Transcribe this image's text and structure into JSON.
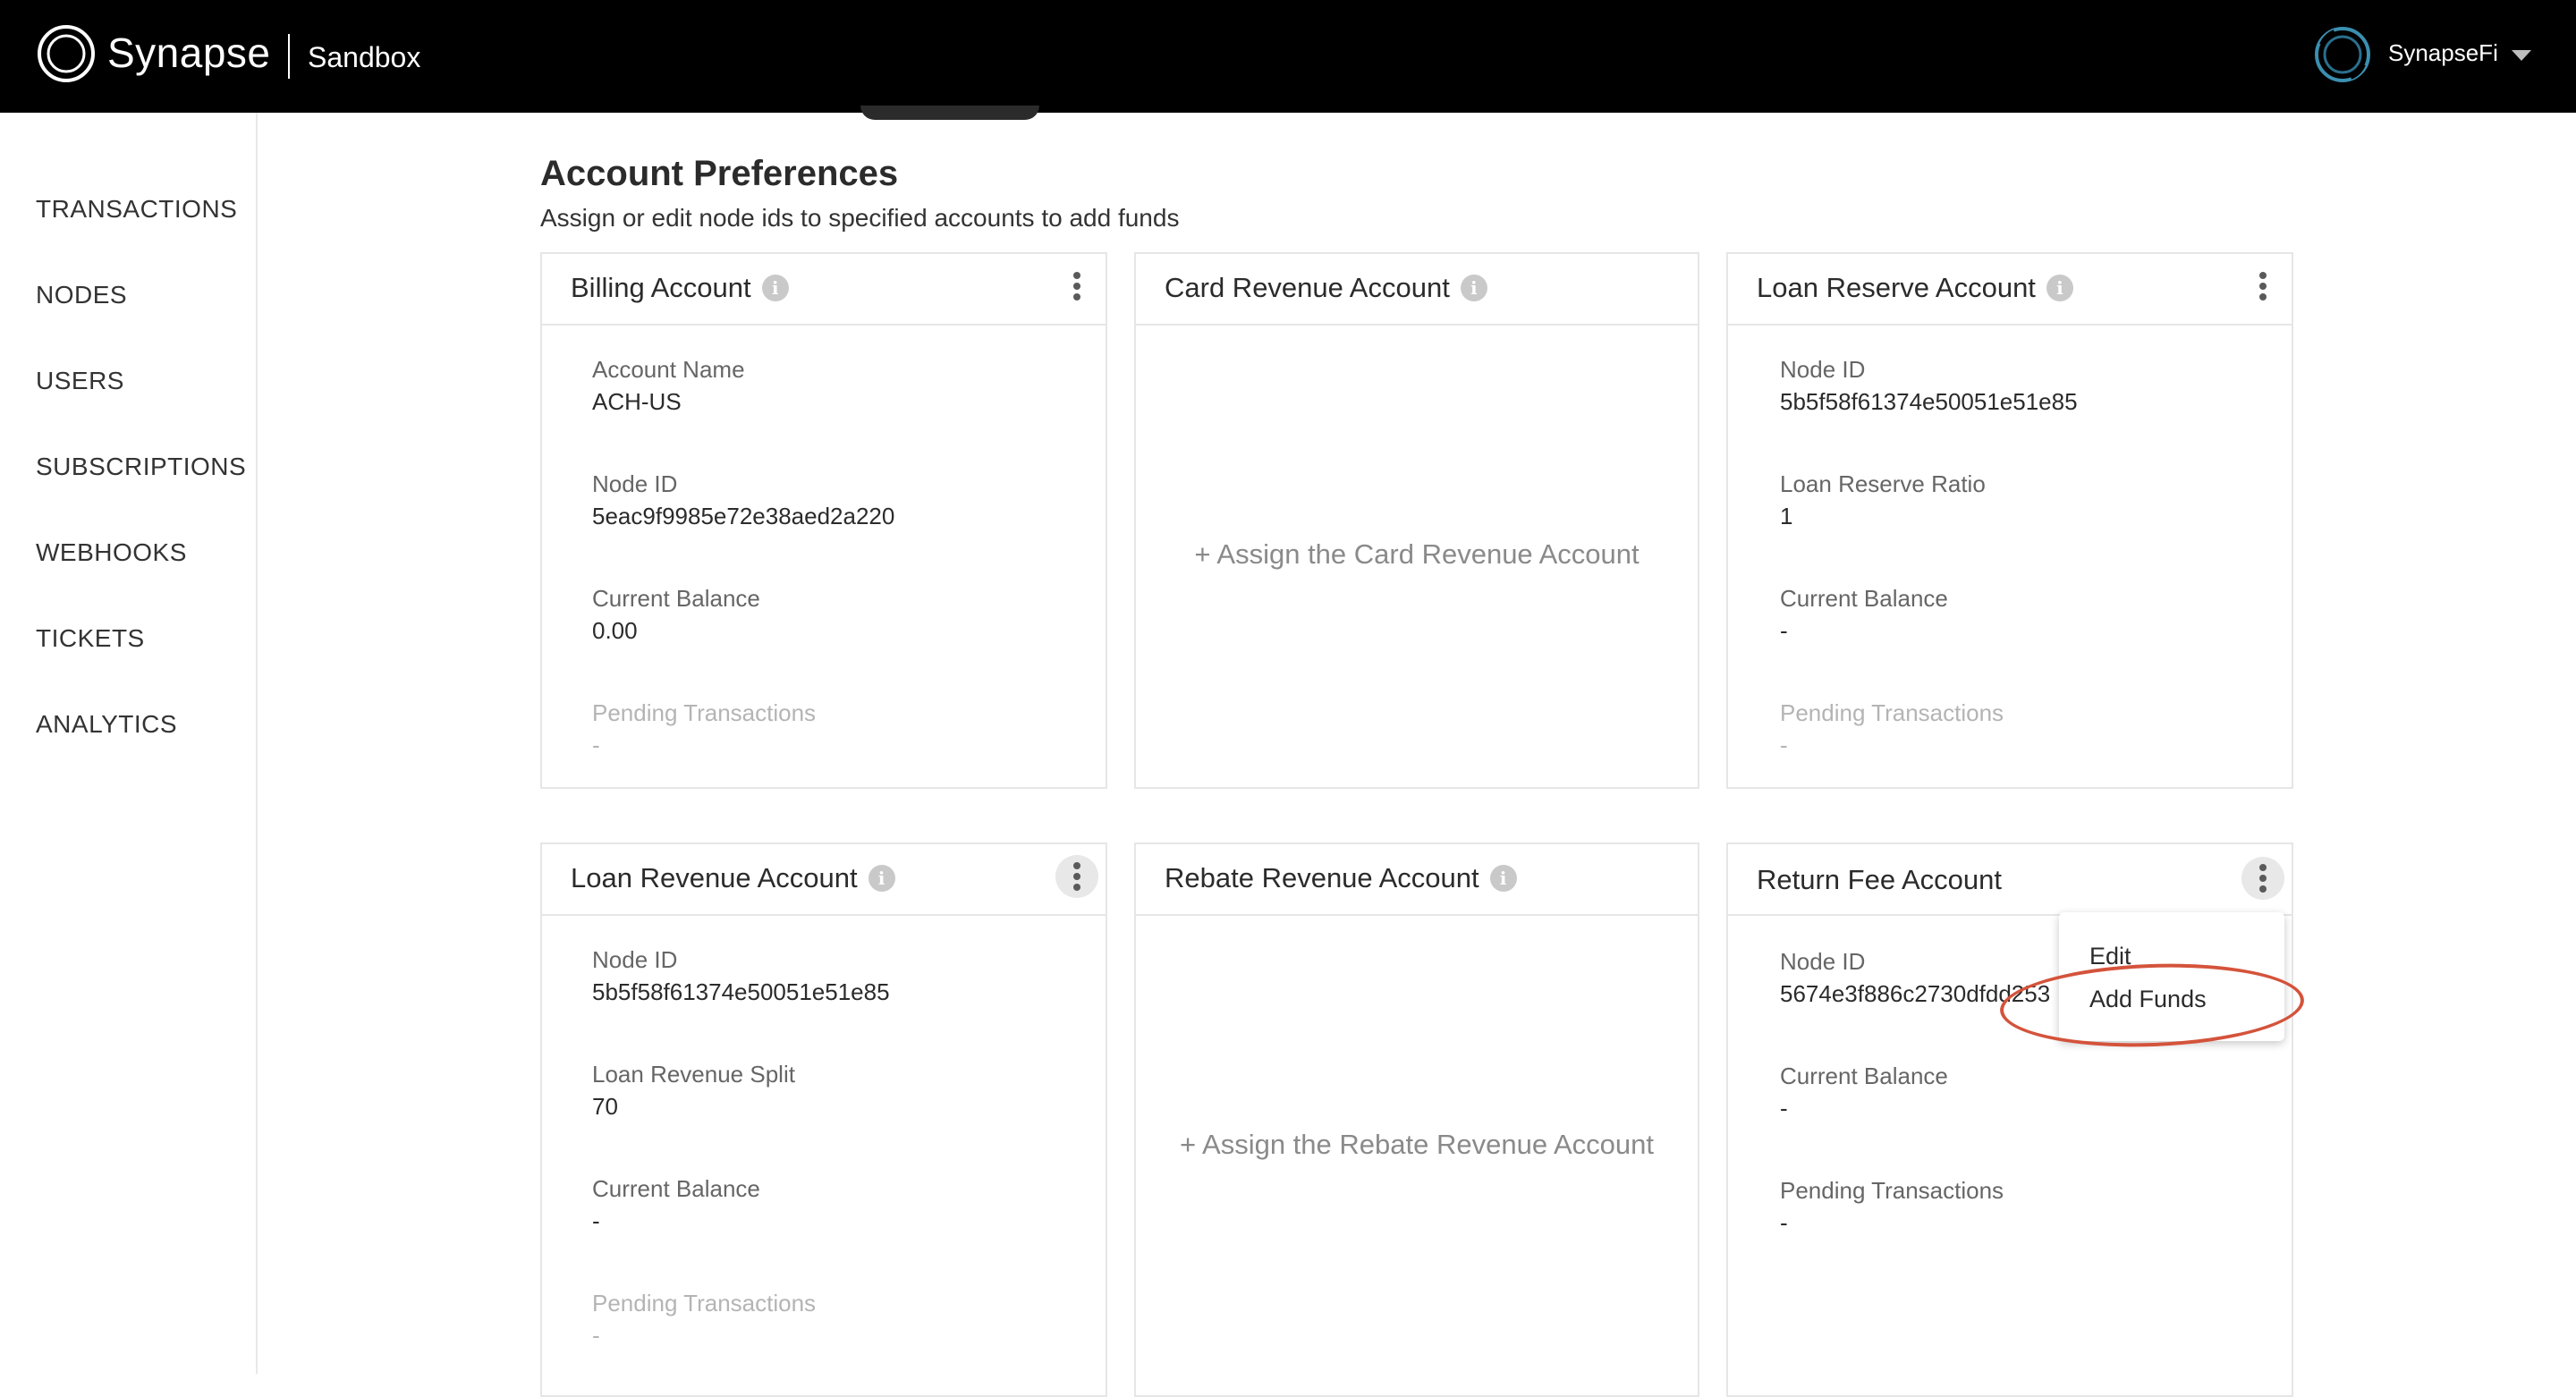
{
  "header": {
    "brand": "Synapse",
    "environment": "Sandbox",
    "org_name": "SynapseFi",
    "icons": {
      "logo": "synapse-logo-icon",
      "org": "org-logo-icon",
      "caret": "caret-down-icon"
    }
  },
  "sidebar": {
    "items": [
      "TRANSACTIONS",
      "NODES",
      "USERS",
      "SUBSCRIPTIONS",
      "WEBHOOKS",
      "TICKETS",
      "ANALYTICS"
    ]
  },
  "page": {
    "title": "Account Preferences",
    "subtitle": "Assign or edit node ids to specified accounts to add funds"
  },
  "cards": {
    "billing": {
      "title": "Billing Account",
      "fields": [
        {
          "label": "Account Name",
          "value": "ACH-US"
        },
        {
          "label": "Node ID",
          "value": "5eac9f9985e72e38aed2a220"
        },
        {
          "label": "Current Balance",
          "value": "0.00"
        },
        {
          "label": "Pending Transactions",
          "value": "-"
        }
      ]
    },
    "card_revenue": {
      "title": "Card Revenue Account",
      "assign": "+ Assign the Card Revenue Account"
    },
    "loan_reserve": {
      "title": "Loan Reserve Account",
      "fields": [
        {
          "label": "Node ID",
          "value": "5b5f58f61374e50051e51e85"
        },
        {
          "label": "Loan Reserve Ratio",
          "value": "1"
        },
        {
          "label": "Current Balance",
          "value": "-"
        },
        {
          "label": "Pending Transactions",
          "value": "-"
        }
      ]
    },
    "loan_revenue": {
      "title": "Loan Revenue Account",
      "fields": [
        {
          "label": "Node ID",
          "value": "5b5f58f61374e50051e51e85"
        },
        {
          "label": "Loan Revenue Split",
          "value": "70"
        },
        {
          "label": "Current Balance",
          "value": "-"
        },
        {
          "label": "Pending Transactions",
          "value": "-"
        }
      ]
    },
    "rebate_revenue": {
      "title": "Rebate Revenue Account",
      "assign": "+ Assign the Rebate Revenue Account"
    },
    "return_fee": {
      "title": "Return Fee Account",
      "fields": [
        {
          "label": "Node ID",
          "value": "5674e3f886c2730dfdd253"
        },
        {
          "label": "Current Balance",
          "value": "-"
        },
        {
          "label": "Pending Transactions",
          "value": "-"
        }
      ]
    }
  },
  "menu": {
    "items": [
      "Edit",
      "Add Funds"
    ]
  },
  "colors": {
    "topbar": "#000000",
    "annotation_ring": "#d4533b",
    "muted_text": "#b4b4b4"
  }
}
